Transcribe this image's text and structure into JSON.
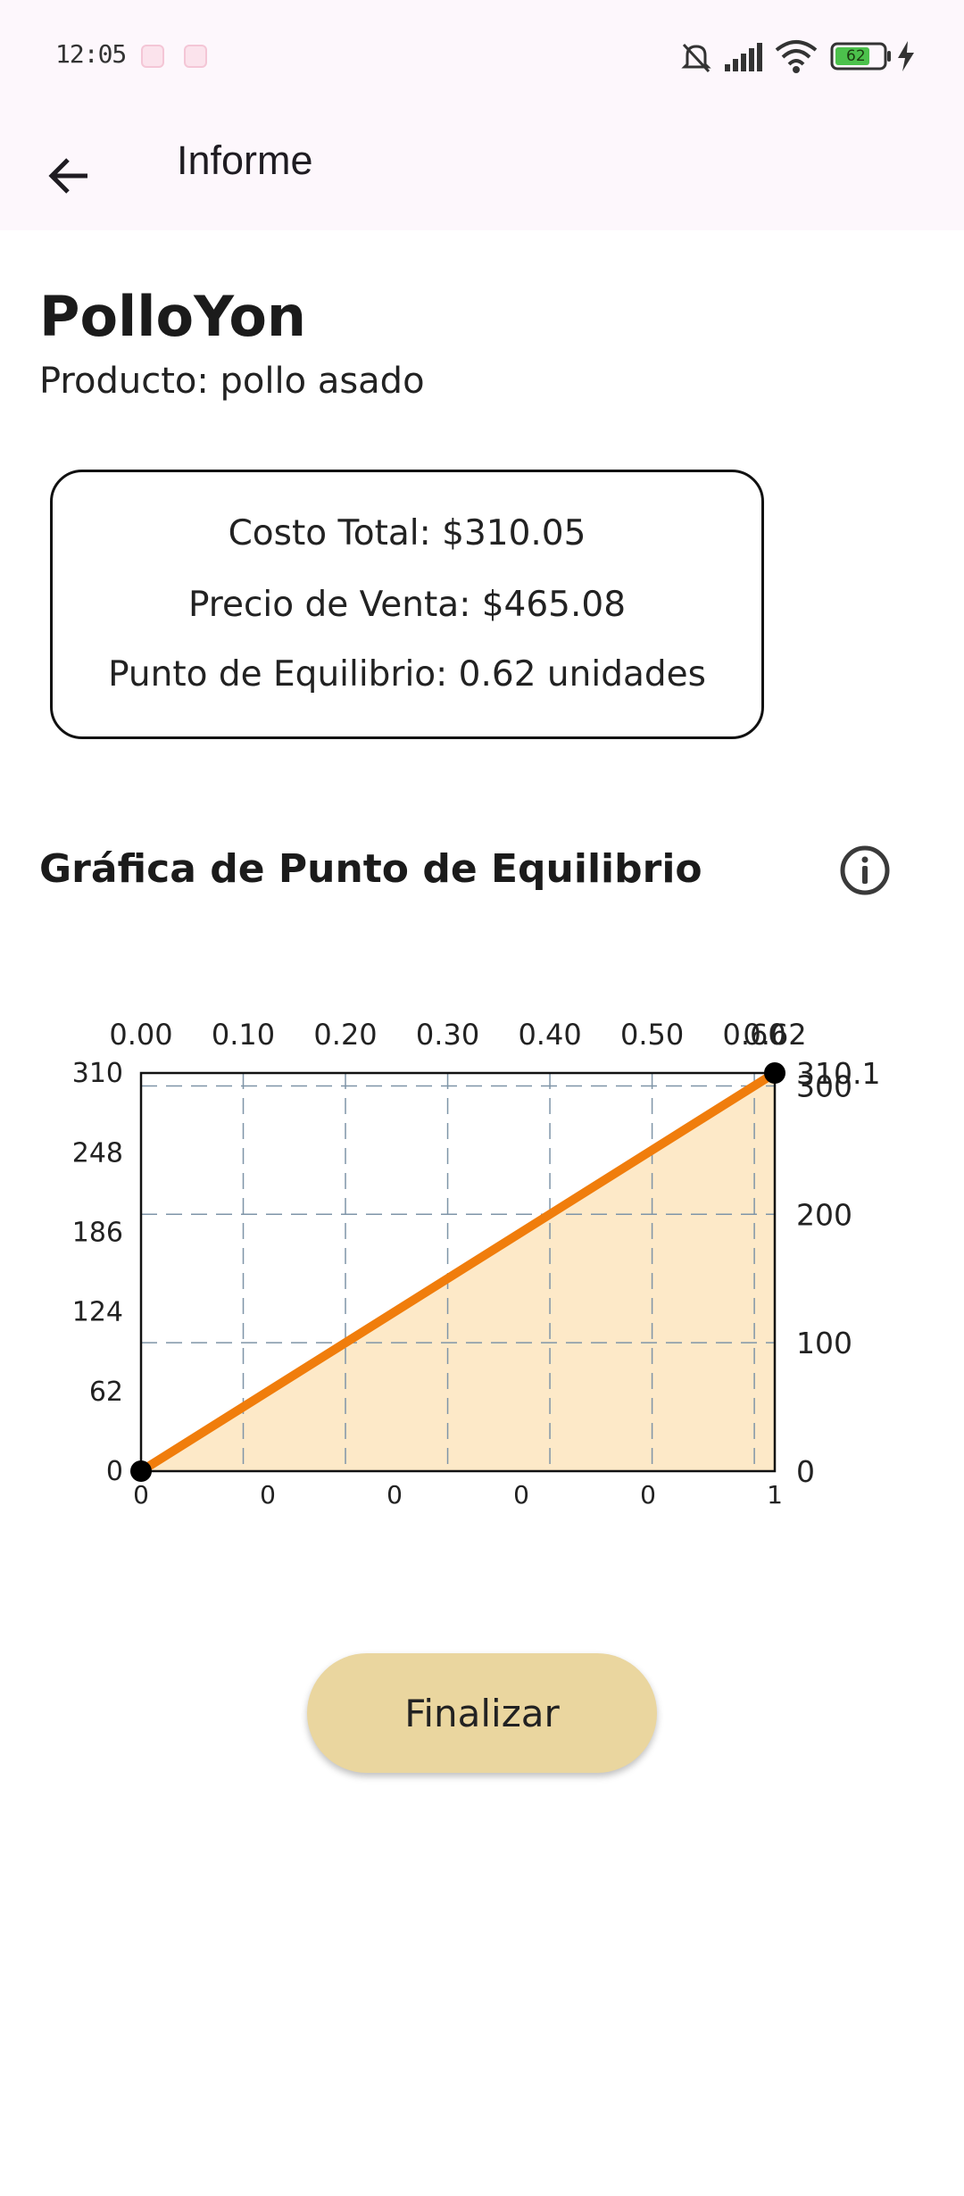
{
  "status_bar": {
    "time": "12:05",
    "battery": "62"
  },
  "app_bar": {
    "title": "Informe"
  },
  "report": {
    "company": "PolloYon",
    "product": "Producto: pollo asado",
    "summary": {
      "total_cost": "Costo Total: $310.05",
      "sale_price": "Precio de Venta: $465.08",
      "breakeven": "Punto de Equilibrio: 0.62 unidades"
    }
  },
  "chart_title": "Gráfica de Punto de Equilibrio",
  "finish_button": "Finalizar",
  "colors": {
    "line": "#f07d0c",
    "fill": "#fde9c8",
    "grid": "#7f95a8",
    "button": "#ead69f",
    "header_bg": "#fdf7fc"
  },
  "chart_data": {
    "type": "line",
    "series": [
      {
        "x": [
          0,
          0.62
        ],
        "y": [
          0,
          310.05
        ]
      }
    ],
    "top_x_ticks": [
      "0.00",
      "0.10",
      "0.20",
      "0.30",
      "0.40",
      "0.50",
      "0.60",
      "0.62"
    ],
    "top_x_values": [
      0,
      0.1,
      0.2,
      0.3,
      0.4,
      0.5,
      0.6,
      0.62
    ],
    "left_y_ticks": [
      "0",
      "62",
      "124",
      "186",
      "248",
      "310"
    ],
    "left_y_values": [
      0,
      62,
      124,
      186,
      248,
      310
    ],
    "right_y_ticks": [
      "0",
      "100",
      "200",
      "300",
      "310.1"
    ],
    "right_y_values": [
      0,
      100,
      200,
      300,
      310.1
    ],
    "bottom_x_ticks": [
      "0",
      "0",
      "0",
      "0",
      "0",
      "1"
    ],
    "bottom_x_values": [
      0,
      0.1,
      0.2,
      0.3,
      0.4,
      0.62
    ],
    "xlim": [
      0,
      0.62
    ],
    "ylim": [
      0,
      310.05
    ],
    "grid": true,
    "area_fill": true
  }
}
